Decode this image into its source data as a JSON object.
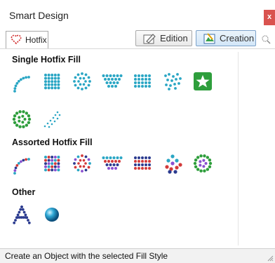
{
  "window": {
    "title": "Smart Design",
    "close_label": "x"
  },
  "tabs": [
    {
      "label": "Hotfix",
      "active": true
    }
  ],
  "toolbar": {
    "edition_label": "Edition",
    "creation_label": "Creation",
    "creation_active": true
  },
  "sections": [
    {
      "title": "Single Hotfix Fill",
      "items": [
        "arc-fill",
        "bar-fill",
        "spiral-fill",
        "fan-fill",
        "grid-fill",
        "scatter-fill",
        "star-fill",
        "ring-fill",
        "spray-fill"
      ]
    },
    {
      "title": "Assorted Hotfix Fill",
      "items": [
        "arc-fill",
        "bar-fill",
        "spiral-fill",
        "fan-fill",
        "grid-fill",
        "cluster-fill",
        "ring-fill"
      ]
    },
    {
      "title": "Other",
      "items": [
        "letter-a-fill",
        "sphere"
      ]
    }
  ],
  "statusbar": {
    "text": "Create an Object with the selected Fill Style"
  },
  "colors": {
    "teal": "#2aa6c4",
    "green": "#2e9e3c",
    "red": "#d23a3a",
    "navy": "#2b3b8f",
    "purple": "#8a4fd0"
  }
}
